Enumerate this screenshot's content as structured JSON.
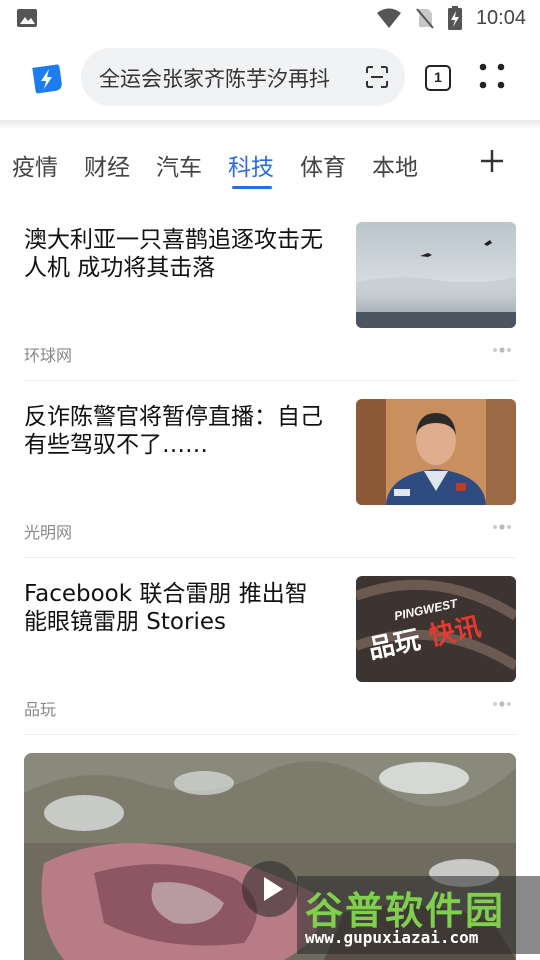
{
  "status_bar": {
    "time": "10:04",
    "icons": [
      "image-icon",
      "wifi-icon",
      "no-sim-icon",
      "battery-charging-icon"
    ]
  },
  "browser": {
    "url_text": "全运会张家齐陈芋汐再抖",
    "tab_count": "1",
    "icons": [
      "browser-logo-icon",
      "scan-icon",
      "more-icon"
    ]
  },
  "categories": {
    "items": [
      "疫情",
      "财经",
      "汽车",
      "科技",
      "体育",
      "本地"
    ],
    "active": "科技"
  },
  "news": [
    {
      "title": "澳大利亚一只喜鹊追逐攻击无人机 成功将其击落",
      "source": "环球网"
    },
    {
      "title": "反诈陈警官将暂停直播：自己有些驾驭不了……",
      "source": "光明网"
    },
    {
      "title": "Facebook 联合雷朋 推出智能眼镜雷朋 Stories",
      "source": "品玩"
    }
  ],
  "thumb3": {
    "brand": "PINGWEST",
    "text_white": "品玩",
    "text_red": "快讯"
  },
  "watermark": {
    "top": "谷普软件园",
    "bottom": "www.gupuxiazai.com"
  },
  "colors": {
    "accent": "#2a6be6",
    "logo": "#1e7cf2"
  }
}
